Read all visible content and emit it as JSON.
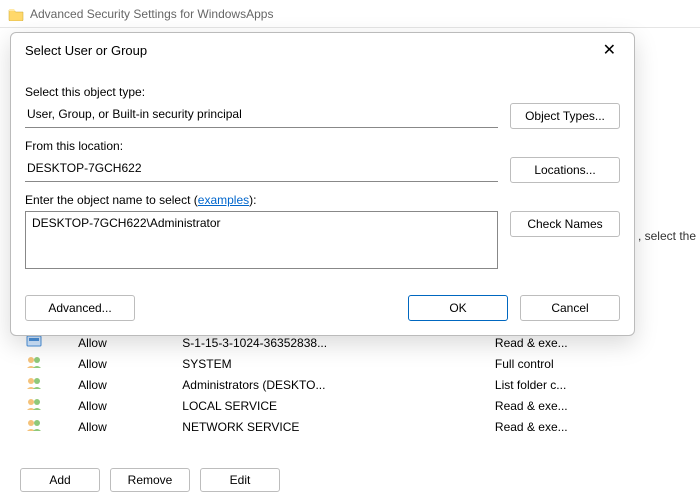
{
  "parent": {
    "title": "Advanced Security Settings for WindowsApps",
    "bg_hint": ", select the",
    "entries": [
      {
        "type": "Allow",
        "principal": "S-1-15-3-1024-36352838...",
        "access": "Read & exe..."
      },
      {
        "type": "Allow",
        "principal": "SYSTEM",
        "access": "Full control"
      },
      {
        "type": "Allow",
        "principal": "Administrators (DESKTO...",
        "access": "List folder c..."
      },
      {
        "type": "Allow",
        "principal": "LOCAL SERVICE",
        "access": "Read & exe..."
      },
      {
        "type": "Allow",
        "principal": "NETWORK SERVICE",
        "access": "Read & exe..."
      }
    ],
    "buttons": {
      "add": "Add",
      "remove": "Remove",
      "edit": "Edit"
    }
  },
  "dialog": {
    "title": "Select User or Group",
    "object_type_label": "Select this object type:",
    "object_type_value": "User, Group, or Built-in security principal",
    "object_types_btn": "Object Types...",
    "location_label": "From this location:",
    "location_value": "DESKTOP-7GCH622",
    "locations_btn": "Locations...",
    "name_label_pre": "Enter the object name to select (",
    "name_label_link": "examples",
    "name_label_post": "):",
    "name_value": "DESKTOP-7GCH622\\Administrator",
    "check_names_btn": "Check Names",
    "advanced_btn": "Advanced...",
    "ok_btn": "OK",
    "cancel_btn": "Cancel"
  }
}
